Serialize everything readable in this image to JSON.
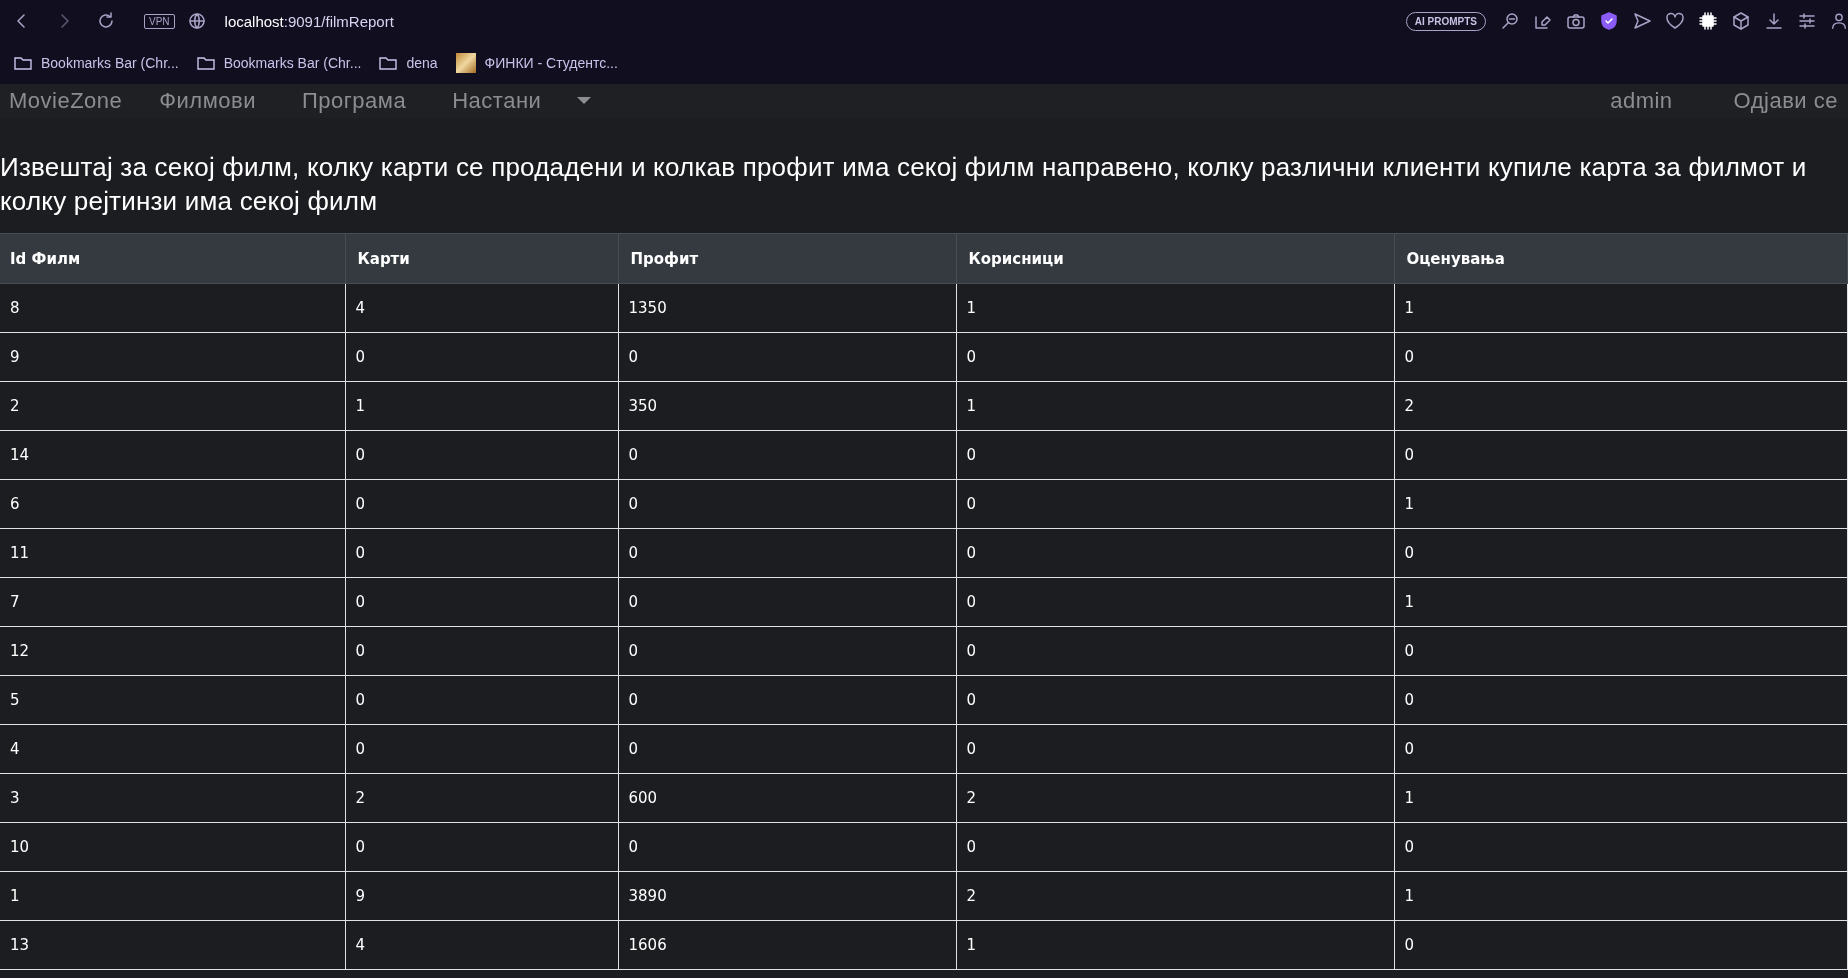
{
  "browser": {
    "url_host": "localhost",
    "url_path": ":9091/filmReport",
    "vpn_badge": "VPN",
    "ai_prompts": "AI PROMPTS",
    "bookmarks": [
      {
        "label": "Bookmarks Bar (Chr...",
        "kind": "folder"
      },
      {
        "label": "Bookmarks Bar (Chr...",
        "kind": "folder"
      },
      {
        "label": "dena",
        "kind": "folder"
      },
      {
        "label": "ФИНКИ - Студентс...",
        "kind": "site"
      }
    ]
  },
  "navbar": {
    "brand": "MovieZone",
    "links": [
      "Филмови",
      "Програма",
      "Настани"
    ],
    "user": "admin",
    "logout": "Одјави се"
  },
  "heading": "Извештај за секој филм, колку карти се продадени и колкав профит има секој филм направено, колку различни клиенти купиле карта за филмот и колку рејтинзи има секој филм",
  "table": {
    "columns": [
      "Id Филм",
      "Карти",
      "Профит",
      "Корисници",
      "Оценувања"
    ],
    "rows": [
      [
        "8",
        "4",
        "1350",
        "1",
        "1"
      ],
      [
        "9",
        "0",
        "0",
        "0",
        "0"
      ],
      [
        "2",
        "1",
        "350",
        "1",
        "2"
      ],
      [
        "14",
        "0",
        "0",
        "0",
        "0"
      ],
      [
        "6",
        "0",
        "0",
        "0",
        "1"
      ],
      [
        "11",
        "0",
        "0",
        "0",
        "0"
      ],
      [
        "7",
        "0",
        "0",
        "0",
        "1"
      ],
      [
        "12",
        "0",
        "0",
        "0",
        "0"
      ],
      [
        "5",
        "0",
        "0",
        "0",
        "0"
      ],
      [
        "4",
        "0",
        "0",
        "0",
        "0"
      ],
      [
        "3",
        "2",
        "600",
        "2",
        "1"
      ],
      [
        "10",
        "0",
        "0",
        "0",
        "0"
      ],
      [
        "1",
        "9",
        "3890",
        "2",
        "1"
      ],
      [
        "13",
        "4",
        "1606",
        "1",
        "0"
      ]
    ]
  }
}
